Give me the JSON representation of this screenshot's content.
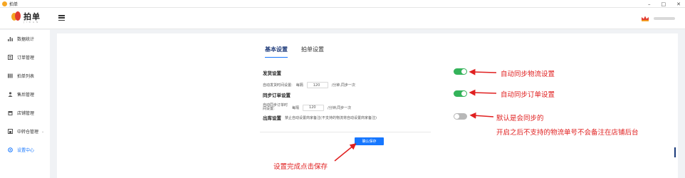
{
  "window": {
    "title": "拍单",
    "minimize": "–",
    "maximize": "□",
    "close": "✕"
  },
  "header": {
    "logo_text": "拍单",
    "logo_sub": "J I   D A N"
  },
  "sidebar": {
    "items": [
      {
        "label": "数据统计",
        "icon": "bar-chart-icon"
      },
      {
        "label": "订单管理",
        "icon": "order-icon"
      },
      {
        "label": "拍单列表",
        "icon": "list-icon"
      },
      {
        "label": "售后管理",
        "icon": "user-icon"
      },
      {
        "label": "店铺管理",
        "icon": "shop-icon"
      },
      {
        "label": "中转仓管理",
        "icon": "warehouse-icon"
      },
      {
        "label": "设置中心",
        "icon": "settings-icon"
      }
    ]
  },
  "tabs": [
    {
      "label": "基本设置",
      "active": true
    },
    {
      "label": "拍单设置",
      "active": false
    }
  ],
  "settings": {
    "ship": {
      "label": "发货设置",
      "prefix": "自动发货时间设置:",
      "every": "每隔",
      "value": "120",
      "suffix": "/分钟,同步一次",
      "enabled": true
    },
    "sync": {
      "label": "同步订单设置",
      "prefix": "自动同步订单时间设置:",
      "every": "每隔",
      "value": "120",
      "suffix": "/分钟,同步一次",
      "enabled": true
    },
    "outbound": {
      "label": "出库设置",
      "desc": "禁止自动设置商家备注(不支持的物流将自动设置商家备注)",
      "enabled": false
    }
  },
  "save_button": "确认保存",
  "annotations": {
    "auto_logistics": "自动同步物流设置",
    "auto_order": "自动同步订单设置",
    "default_sync_1": "默认是会同步的",
    "default_sync_2": "开启之后不支持的物流单号不会备注在店铺后台",
    "save_hint": "设置完成点击保存"
  },
  "colors": {
    "accent": "#1677ff",
    "toggle_on": "#34b35a",
    "annotation": "#e02020"
  }
}
